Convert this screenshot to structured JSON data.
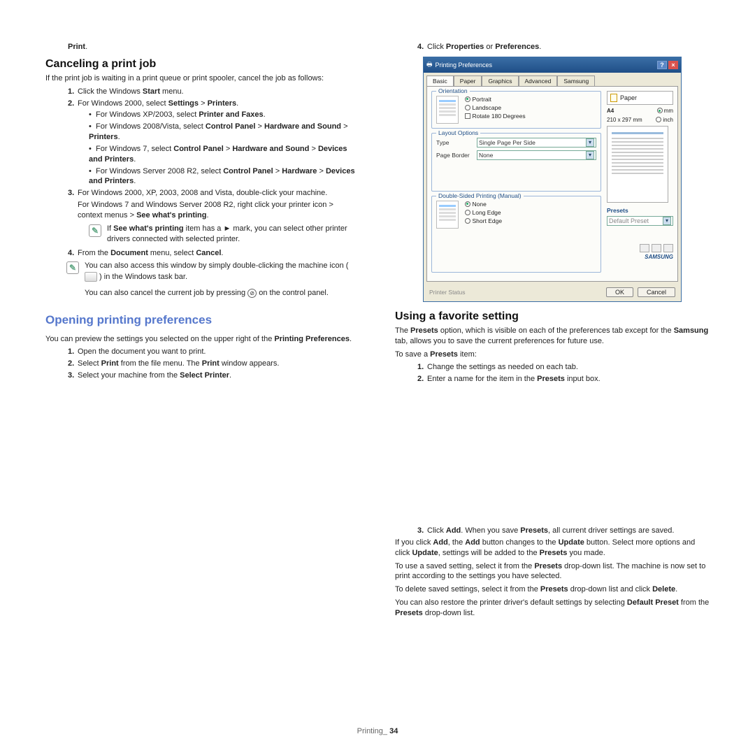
{
  "left": {
    "print_bold": "Print",
    "print_dot": ".",
    "h_cancel": "Canceling a print job",
    "cancel_intro": "If the print job is waiting in a print queue or print spooler, cancel the job as follows:",
    "s1a": "Click the Windows ",
    "s1b": "Start",
    "s1c": " menu.",
    "s2a": "For Windows 2000, select ",
    "s2b": "Settings",
    "s2c": "Printers",
    "b1a": "For Windows XP/2003, select ",
    "b1b": "Printer and Faxes",
    "b2a": "For Windows 2008/Vista, select ",
    "b2b": "Control Panel",
    "b2c": "Hardware and Sound",
    "b2d": "Printers",
    "b3a": "For Windows 7, select ",
    "b3b": "Control Panel",
    "b3c": "Hardware and Sound",
    "b3d": "Devices and Printers",
    "b4a": "For Windows Server 2008 R2, select ",
    "b4b": "Control Panel",
    "b4c": "Hardware",
    "b4d": "Devices and Printers",
    "s3a": "For Windows 2000, XP, 2003, 2008 and Vista, double-click your machine.",
    "s3b": "For Windows 7 and Windows Server 2008 R2, right click your printer icon > context menus > ",
    "s3c": "See what's printing",
    "tip1a": "If ",
    "tip1b": "See what's printing",
    "tip1c": " item has a ► mark, you can select other printer drivers connected with selected printer.",
    "s4a": "From the ",
    "s4b": "Document",
    "s4c": " menu, select ",
    "s4d": "Cancel",
    "tip2a": "You can also access this window by simply double-clicking the machine icon ( ",
    "tip2b": " ) in the Windows task bar.",
    "tip2c": "You can also cancel the current job by pressing ",
    "tip2d": " on the control panel.",
    "h_open": "Opening printing preferences",
    "open_intro_a": "You can preview the settings you selected on the upper right of the ",
    "open_intro_b": "Printing Preferences",
    "o1": "Open the document you want to print.",
    "o2a": "Select ",
    "o2b": "Print",
    "o2c": " from the file menu. The ",
    "o2d": "Print",
    "o2e": " window appears.",
    "o3a": "Select your machine from the ",
    "o3b": "Select Printer"
  },
  "right": {
    "s4a": "Click ",
    "s4b": "Properties",
    "s4c": " or ",
    "s4d": "Preferences",
    "h_fav": "Using a favorite setting",
    "fav1a": "The ",
    "fav1b": "Presets",
    "fav1c": " option, which is visible on each of the preferences tab except for the ",
    "fav1d": "Samsung",
    "fav1e": " tab, allows you to save the current preferences for future use.",
    "fav2a": "To save a ",
    "fav2b": "Presets",
    "fav2c": " item:",
    "p1": "Change the settings as needed on each tab.",
    "p2a": "Enter a name for the item in the ",
    "p2b": "Presets",
    "p2c": " input box.",
    "p3a": "Click ",
    "p3b": "Add",
    "p3c": ". When you save ",
    "p3d": "Presets",
    "p3e": ", all current driver settings are saved.",
    "r1a": "If you click ",
    "r1b": "Add",
    "r1c": ", the ",
    "r1d": "Add",
    "r1e": " button changes to the ",
    "r1f": "Update",
    "r1g": " button. Select more options and click ",
    "r1h": "Update",
    "r1i": ", settings will be added to the ",
    "r1j": "Presets",
    "r1k": " you made.",
    "r2a": "To use a saved setting, select it from the ",
    "r2b": "Presets",
    "r2c": " drop-down list. The machine is now set to print according to the settings you have selected.",
    "r3a": "To delete saved settings, select it from the ",
    "r3b": "Presets",
    "r3c": " drop-down list and click ",
    "r3d": "Delete",
    "r4a": "You can also restore the printer driver's default settings by selecting ",
    "r4b": "Default Preset",
    "r4c": " from the ",
    "r4d": "Presets",
    "r4e": " drop-down list."
  },
  "dialog": {
    "title": "Printing Preferences",
    "tabs": [
      "Basic",
      "Paper",
      "Graphics",
      "Advanced",
      "Samsung"
    ],
    "orientation": "Orientation",
    "portrait": "Portrait",
    "landscape": "Landscape",
    "rotate": "Rotate 180 Degrees",
    "layout": "Layout Options",
    "type": "Type",
    "type_val": "Single Page Per Side",
    "border": "Page Border",
    "border_val": "None",
    "duplex": "Double-Sided Printing (Manual)",
    "none": "None",
    "long": "Long Edge",
    "short": "Short Edge",
    "paper": "Paper",
    "a4": "A4",
    "size": "210 x 297 mm",
    "mm": "mm",
    "inch": "inch",
    "presets": "Presets",
    "preset_val": "Default Preset",
    "status": "Printer Status",
    "ok": "OK",
    "cancel": "Cancel",
    "brand": "SAMSUNG"
  },
  "footer": {
    "label": "Printing_",
    "page": "34"
  },
  "gt": ">",
  "dot": "."
}
